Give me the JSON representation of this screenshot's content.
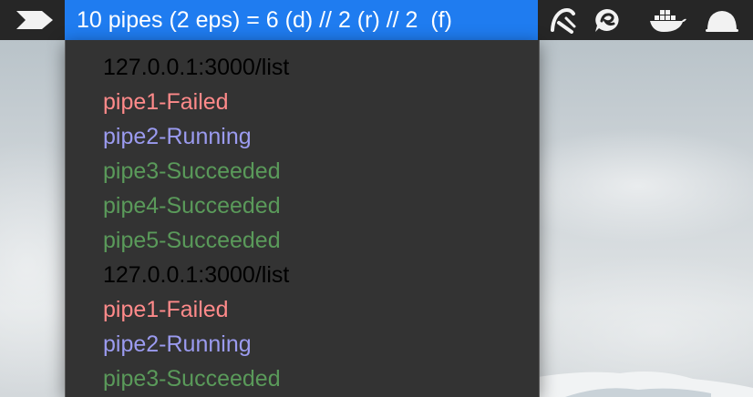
{
  "menubar": {
    "status_title": "10 pipes (2 eps) = 6 (d) // 2 (r) // 2  (f)",
    "icons": [
      "send-arrow-icon",
      "brush-app-icon",
      "chat-swirl-icon",
      "docker-whale-icon",
      "cloud-dome-icon"
    ]
  },
  "colors": {
    "menubar_bg": "#262626",
    "status_highlight": "#1f7cf0",
    "dropdown_bg": "#333333",
    "endpoint": "#000000",
    "failed": "#ff8a8a",
    "running": "#9b9bf0",
    "succeeded": "#5a9a5a"
  },
  "dropdown": {
    "items": [
      {
        "label": "127.0.0.1:3000/list",
        "status": "endpoint"
      },
      {
        "label": "pipe1-Failed",
        "status": "failed"
      },
      {
        "label": "pipe2-Running",
        "status": "running"
      },
      {
        "label": "pipe3-Succeeded",
        "status": "succeeded"
      },
      {
        "label": "pipe4-Succeeded",
        "status": "succeeded"
      },
      {
        "label": "pipe5-Succeeded",
        "status": "succeeded"
      },
      {
        "label": "127.0.0.1:3000/list",
        "status": "endpoint"
      },
      {
        "label": "pipe1-Failed",
        "status": "failed"
      },
      {
        "label": "pipe2-Running",
        "status": "running"
      },
      {
        "label": "pipe3-Succeeded",
        "status": "succeeded"
      }
    ]
  }
}
